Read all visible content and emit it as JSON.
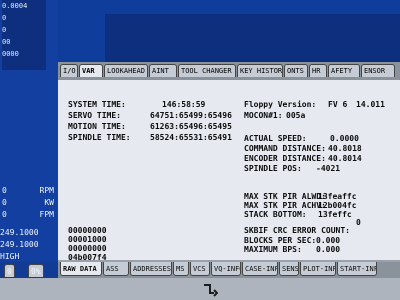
{
  "left": {
    "top_lines": [
      "0.0004",
      "0",
      "0",
      "00",
      "0000"
    ],
    "unit_rows": [
      {
        "value": "0",
        "unit": "RPM"
      },
      {
        "value": "0",
        "unit": "KW"
      },
      {
        "value": "0",
        "unit": "FPM"
      }
    ],
    "numbers": [
      "249.1000",
      "249.1000"
    ],
    "high": "HIGH",
    "bottom_left": "0",
    "bottom_right": "0%"
  },
  "tabs": [
    "I/O",
    "VAR",
    "LOOKAHEAD",
    "AINT",
    "TOOL CHANGER",
    "KEY HISTORY",
    "ONTS",
    "HR",
    "AFETY",
    "ENSOR"
  ],
  "main": {
    "system_time_label": "SYSTEM TIME:",
    "system_time_value": "146:58:59",
    "servo_time_label": "SERVO TIME:",
    "servo_time_value": "64751:65499:65496",
    "motion_time_label": "MOTION TIME:",
    "motion_time_value": "61263:65496:65495",
    "spindle_time_label": "SPINDLE TIME:",
    "spindle_time_value": "58524:65531:65491",
    "floppy_label": "Floppy Version:",
    "floppy_value": "FV 6",
    "floppy_version_number": "14.011",
    "mocon_label": "MOCON#1:",
    "mocon_value": "005a",
    "actual_speed_label": "ACTUAL SPEED:",
    "actual_speed_value": "0.0000",
    "command_distance_label": "COMMAND DISTANCE:",
    "command_distance_value": "40.8018",
    "encoder_distance_label": "ENCODER DISTANCE:",
    "encoder_distance_value": "40.8014",
    "spindle_pos_label": "SPINDLE POS:",
    "spindle_pos_value": "-4021",
    "max_stk_alwd_label": "MAX STK PIR ALWD:",
    "max_stk_alwd_value": "13feaffc",
    "max_stk_achv_label": "MAX STK PIR ACHV:",
    "max_stk_achv_value": "12b004fc",
    "stack_bottom_label": "STACK BOTTOM:",
    "stack_bottom_value": "13feffc",
    "stack_zero": "0",
    "skbif_crc_label": "SKBIF CRC ERROR COUNT:",
    "blocks_per_sec_label": "BLOCKS PER SEC:",
    "blocks_per_sec_value": "0.000",
    "maximum_bps_label": "MAXIMUM BPS:",
    "maximum_bps_value": "0.000",
    "codes": [
      "00000000",
      "00001000",
      "00000000",
      "04b007f4"
    ]
  },
  "bottom_tabs": [
    "RAW DATA",
    "ASS",
    "ADDRESSES",
    "MS",
    "VCS",
    "VQ-INFO",
    "CASE-INFO",
    "SENS",
    "PLOT-INFO",
    "START-INFO"
  ],
  "colors": {
    "blue": "#123fa0",
    "panel": "#e6eaf0",
    "tab": "#c6ccd5"
  }
}
